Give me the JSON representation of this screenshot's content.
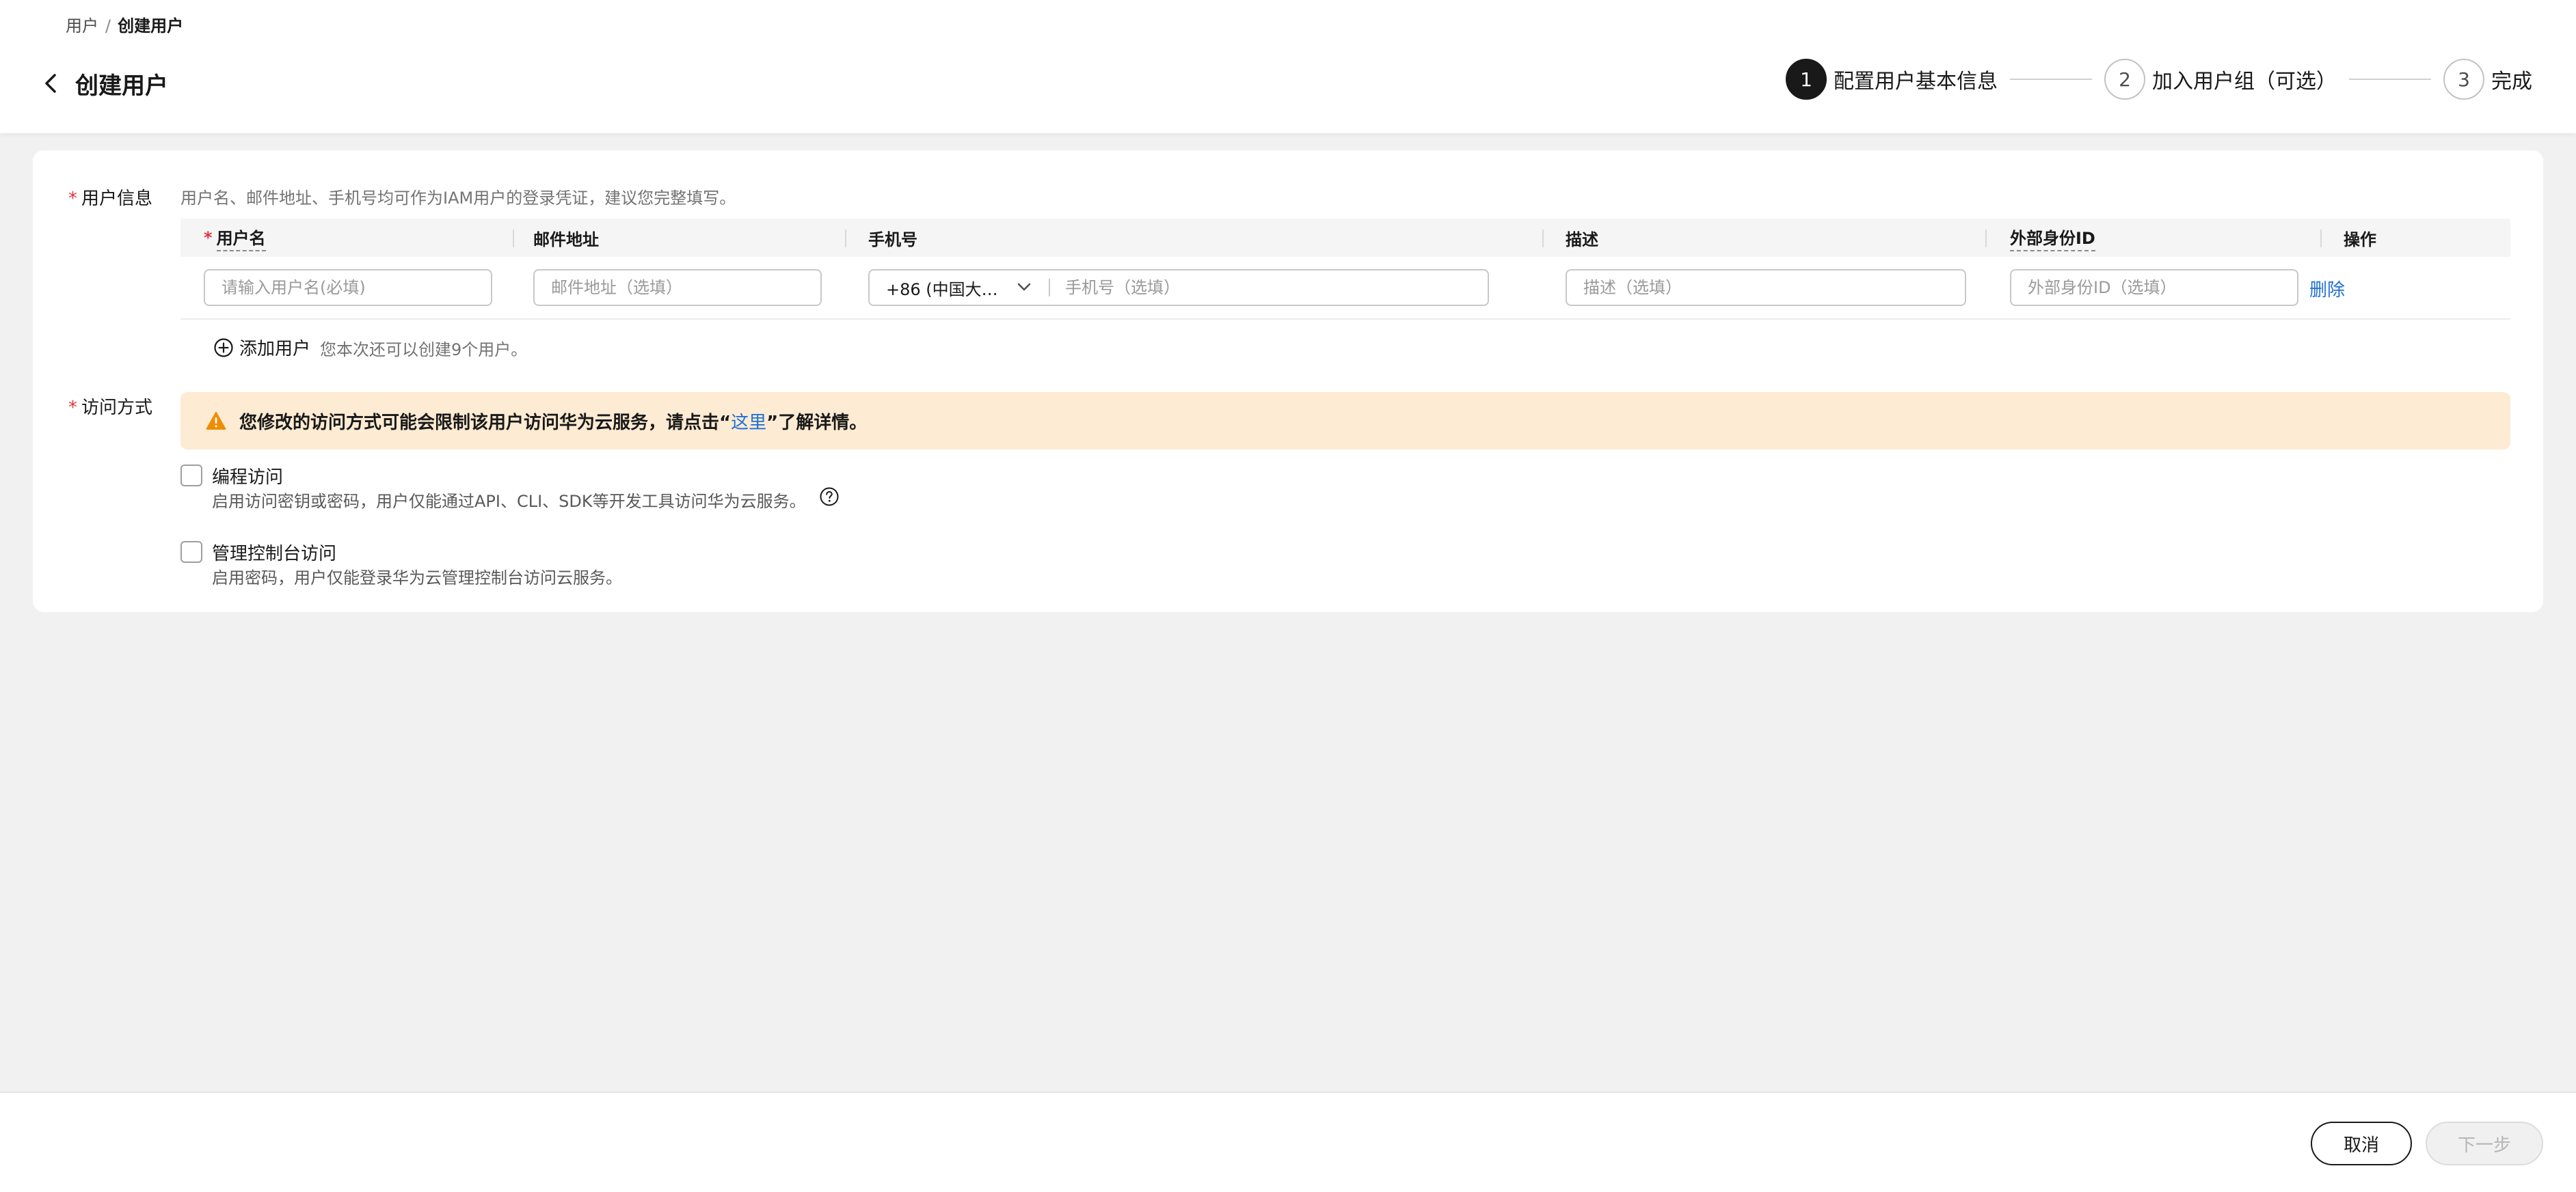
{
  "breadcrumb": {
    "parent": "用户",
    "separator": "/",
    "current": "创建用户"
  },
  "header": {
    "title": "创建用户"
  },
  "steps": [
    {
      "number": "1",
      "label": "配置用户基本信息",
      "active": true
    },
    {
      "number": "2",
      "label": "加入用户组（可选）",
      "active": false
    },
    {
      "number": "3",
      "label": "完成",
      "active": false
    }
  ],
  "user_info": {
    "label": "用户信息",
    "hint": "用户名、邮件地址、手机号均可作为IAM用户的登录凭证，建议您完整填写。",
    "columns": {
      "username": "用户名",
      "email": "邮件地址",
      "phone": "手机号",
      "description": "描述",
      "external_id": "外部身份ID",
      "actions": "操作"
    },
    "row": {
      "username_placeholder": "请输入用户名(必填)",
      "email_placeholder": "邮件地址（选填）",
      "country_code": "+86 (中国大…",
      "phone_placeholder": "手机号（选填）",
      "description_placeholder": "描述（选填）",
      "external_id_placeholder": "外部身份ID（选填）",
      "delete_label": "删除"
    },
    "add_user_label": "添加用户",
    "add_user_hint": "您本次还可以创建9个用户。"
  },
  "access": {
    "label": "访问方式",
    "warning_prefix": "您修改的访问方式可能会限制该用户访问华为云服务，请点击“",
    "warning_link": "这里",
    "warning_suffix": "”了解详情。",
    "programmatic": {
      "title": "编程访问",
      "desc": "启用访问密钥或密码，用户仅能通过API、CLI、SDK等开发工具访问华为云服务。"
    },
    "console": {
      "title": "管理控制台访问",
      "desc": "启用密码，用户仅能登录华为云管理控制台访问云服务。"
    }
  },
  "footer": {
    "cancel_label": "取消",
    "next_label": "下一步"
  },
  "colors": {
    "accent_link": "#1f6fd6",
    "required_mark": "#e3343b",
    "warning_bg": "#fdebd3",
    "warning_icon": "#f08c00"
  }
}
